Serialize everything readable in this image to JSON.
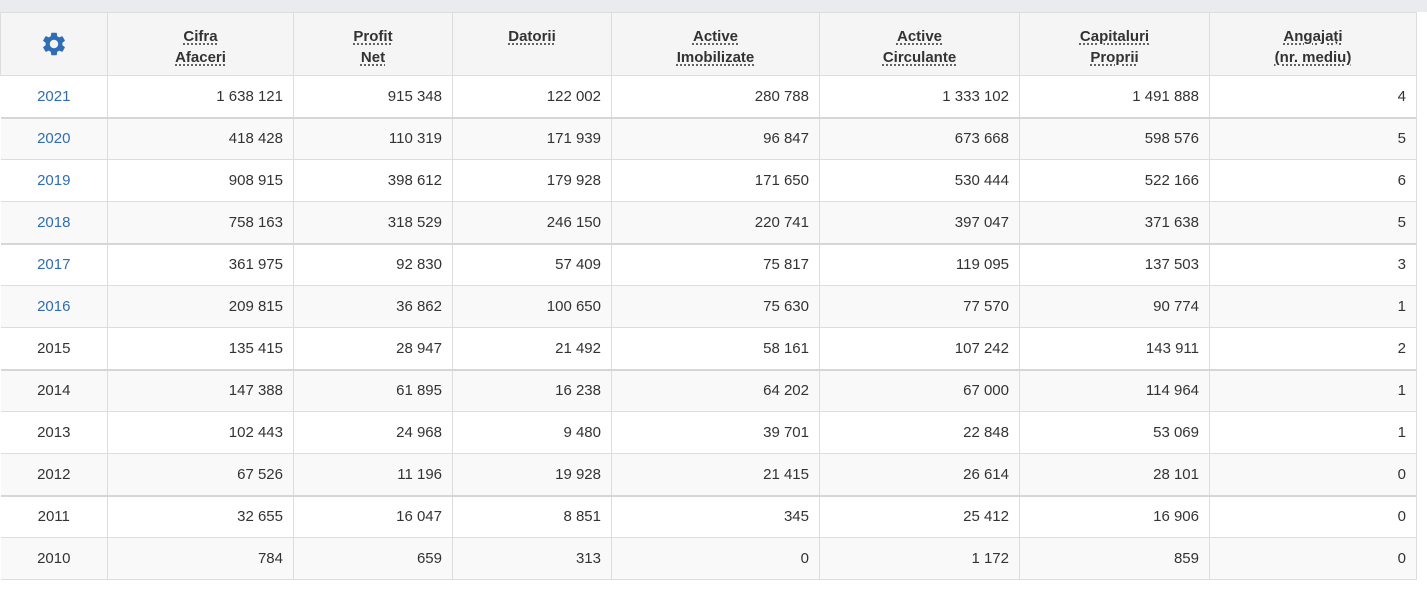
{
  "colors": {
    "link": "#2f6db5",
    "settings_icon": "#2f6db5",
    "header_bg": "#f5f5f5",
    "stripe_bg": "#f9f9f9"
  },
  "settings": {
    "icon": "gear-icon"
  },
  "headers": [
    {
      "line1": "Cifra",
      "line2": "Afaceri"
    },
    {
      "line1": "Profit",
      "line2": "Net"
    },
    {
      "line1": "Datorii",
      "line2": ""
    },
    {
      "line1": "Active",
      "line2": "Imobilizate"
    },
    {
      "line1": "Active",
      "line2": "Circulante"
    },
    {
      "line1": "Capitaluri",
      "line2": "Proprii"
    },
    {
      "line1": "Angajați",
      "line2": "(nr. mediu)"
    }
  ],
  "rows": [
    {
      "year": "2021",
      "link": true,
      "values": [
        "1 638 121",
        "915 348",
        "122 002",
        "280 788",
        "1 333 102",
        "1 491 888",
        "4"
      ]
    },
    {
      "year": "2020",
      "link": true,
      "values": [
        "418 428",
        "110 319",
        "171 939",
        "96 847",
        "673 668",
        "598 576",
        "5"
      ]
    },
    {
      "year": "2019",
      "link": true,
      "values": [
        "908 915",
        "398 612",
        "179 928",
        "171 650",
        "530 444",
        "522 166",
        "6"
      ]
    },
    {
      "year": "2018",
      "link": true,
      "values": [
        "758 163",
        "318 529",
        "246 150",
        "220 741",
        "397 047",
        "371 638",
        "5"
      ]
    },
    {
      "year": "2017",
      "link": true,
      "values": [
        "361 975",
        "92 830",
        "57 409",
        "75 817",
        "119 095",
        "137 503",
        "3"
      ]
    },
    {
      "year": "2016",
      "link": true,
      "values": [
        "209 815",
        "36 862",
        "100 650",
        "75 630",
        "77 570",
        "90 774",
        "1"
      ]
    },
    {
      "year": "2015",
      "link": false,
      "values": [
        "135 415",
        "28 947",
        "21 492",
        "58 161",
        "107 242",
        "143 911",
        "2"
      ]
    },
    {
      "year": "2014",
      "link": false,
      "values": [
        "147 388",
        "61 895",
        "16 238",
        "64 202",
        "67 000",
        "114 964",
        "1"
      ]
    },
    {
      "year": "2013",
      "link": false,
      "values": [
        "102 443",
        "24 968",
        "9 480",
        "39 701",
        "22 848",
        "53 069",
        "1"
      ]
    },
    {
      "year": "2012",
      "link": false,
      "values": [
        "67 526",
        "11 196",
        "19 928",
        "21 415",
        "26 614",
        "28 101",
        "0"
      ]
    },
    {
      "year": "2011",
      "link": false,
      "values": [
        "32 655",
        "16 047",
        "8 851",
        "345",
        "25 412",
        "16 906",
        "0"
      ]
    },
    {
      "year": "2010",
      "link": false,
      "values": [
        "784",
        "659",
        "313",
        "0",
        "1 172",
        "859",
        "0"
      ]
    }
  ]
}
